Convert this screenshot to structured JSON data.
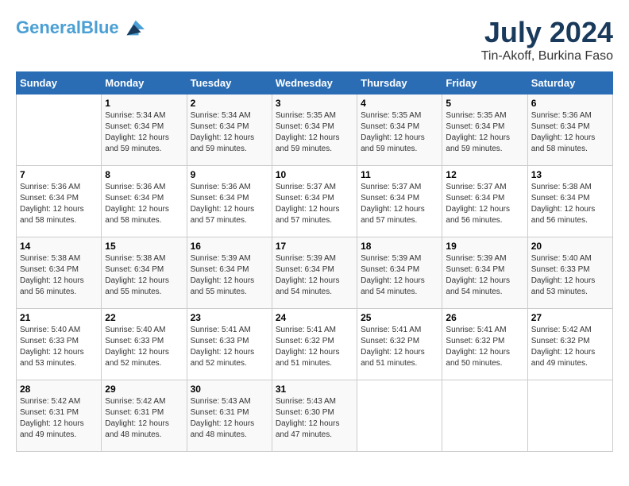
{
  "header": {
    "logo_line1": "General",
    "logo_line2": "Blue",
    "title": "July 2024",
    "subtitle": "Tin-Akoff, Burkina Faso"
  },
  "days_of_week": [
    "Sunday",
    "Monday",
    "Tuesday",
    "Wednesday",
    "Thursday",
    "Friday",
    "Saturday"
  ],
  "weeks": [
    [
      {
        "day": "",
        "info": ""
      },
      {
        "day": "1",
        "info": "Sunrise: 5:34 AM\nSunset: 6:34 PM\nDaylight: 12 hours\nand 59 minutes."
      },
      {
        "day": "2",
        "info": "Sunrise: 5:34 AM\nSunset: 6:34 PM\nDaylight: 12 hours\nand 59 minutes."
      },
      {
        "day": "3",
        "info": "Sunrise: 5:35 AM\nSunset: 6:34 PM\nDaylight: 12 hours\nand 59 minutes."
      },
      {
        "day": "4",
        "info": "Sunrise: 5:35 AM\nSunset: 6:34 PM\nDaylight: 12 hours\nand 59 minutes."
      },
      {
        "day": "5",
        "info": "Sunrise: 5:35 AM\nSunset: 6:34 PM\nDaylight: 12 hours\nand 59 minutes."
      },
      {
        "day": "6",
        "info": "Sunrise: 5:36 AM\nSunset: 6:34 PM\nDaylight: 12 hours\nand 58 minutes."
      }
    ],
    [
      {
        "day": "7",
        "info": "Sunrise: 5:36 AM\nSunset: 6:34 PM\nDaylight: 12 hours\nand 58 minutes."
      },
      {
        "day": "8",
        "info": "Sunrise: 5:36 AM\nSunset: 6:34 PM\nDaylight: 12 hours\nand 58 minutes."
      },
      {
        "day": "9",
        "info": "Sunrise: 5:36 AM\nSunset: 6:34 PM\nDaylight: 12 hours\nand 57 minutes."
      },
      {
        "day": "10",
        "info": "Sunrise: 5:37 AM\nSunset: 6:34 PM\nDaylight: 12 hours\nand 57 minutes."
      },
      {
        "day": "11",
        "info": "Sunrise: 5:37 AM\nSunset: 6:34 PM\nDaylight: 12 hours\nand 57 minutes."
      },
      {
        "day": "12",
        "info": "Sunrise: 5:37 AM\nSunset: 6:34 PM\nDaylight: 12 hours\nand 56 minutes."
      },
      {
        "day": "13",
        "info": "Sunrise: 5:38 AM\nSunset: 6:34 PM\nDaylight: 12 hours\nand 56 minutes."
      }
    ],
    [
      {
        "day": "14",
        "info": "Sunrise: 5:38 AM\nSunset: 6:34 PM\nDaylight: 12 hours\nand 56 minutes."
      },
      {
        "day": "15",
        "info": "Sunrise: 5:38 AM\nSunset: 6:34 PM\nDaylight: 12 hours\nand 55 minutes."
      },
      {
        "day": "16",
        "info": "Sunrise: 5:39 AM\nSunset: 6:34 PM\nDaylight: 12 hours\nand 55 minutes."
      },
      {
        "day": "17",
        "info": "Sunrise: 5:39 AM\nSunset: 6:34 PM\nDaylight: 12 hours\nand 54 minutes."
      },
      {
        "day": "18",
        "info": "Sunrise: 5:39 AM\nSunset: 6:34 PM\nDaylight: 12 hours\nand 54 minutes."
      },
      {
        "day": "19",
        "info": "Sunrise: 5:39 AM\nSunset: 6:34 PM\nDaylight: 12 hours\nand 54 minutes."
      },
      {
        "day": "20",
        "info": "Sunrise: 5:40 AM\nSunset: 6:33 PM\nDaylight: 12 hours\nand 53 minutes."
      }
    ],
    [
      {
        "day": "21",
        "info": "Sunrise: 5:40 AM\nSunset: 6:33 PM\nDaylight: 12 hours\nand 53 minutes."
      },
      {
        "day": "22",
        "info": "Sunrise: 5:40 AM\nSunset: 6:33 PM\nDaylight: 12 hours\nand 52 minutes."
      },
      {
        "day": "23",
        "info": "Sunrise: 5:41 AM\nSunset: 6:33 PM\nDaylight: 12 hours\nand 52 minutes."
      },
      {
        "day": "24",
        "info": "Sunrise: 5:41 AM\nSunset: 6:32 PM\nDaylight: 12 hours\nand 51 minutes."
      },
      {
        "day": "25",
        "info": "Sunrise: 5:41 AM\nSunset: 6:32 PM\nDaylight: 12 hours\nand 51 minutes."
      },
      {
        "day": "26",
        "info": "Sunrise: 5:41 AM\nSunset: 6:32 PM\nDaylight: 12 hours\nand 50 minutes."
      },
      {
        "day": "27",
        "info": "Sunrise: 5:42 AM\nSunset: 6:32 PM\nDaylight: 12 hours\nand 49 minutes."
      }
    ],
    [
      {
        "day": "28",
        "info": "Sunrise: 5:42 AM\nSunset: 6:31 PM\nDaylight: 12 hours\nand 49 minutes."
      },
      {
        "day": "29",
        "info": "Sunrise: 5:42 AM\nSunset: 6:31 PM\nDaylight: 12 hours\nand 48 minutes."
      },
      {
        "day": "30",
        "info": "Sunrise: 5:43 AM\nSunset: 6:31 PM\nDaylight: 12 hours\nand 48 minutes."
      },
      {
        "day": "31",
        "info": "Sunrise: 5:43 AM\nSunset: 6:30 PM\nDaylight: 12 hours\nand 47 minutes."
      },
      {
        "day": "",
        "info": ""
      },
      {
        "day": "",
        "info": ""
      },
      {
        "day": "",
        "info": ""
      }
    ]
  ]
}
